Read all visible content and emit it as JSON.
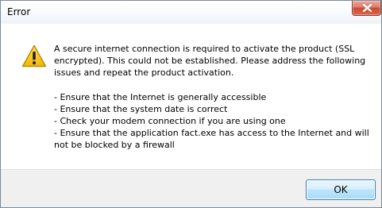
{
  "window": {
    "title": "Error"
  },
  "message": {
    "intro": "A secure internet connection is required to activate the product (SSL encrypted). This could not be established. Please address the following issues and repeat the product activation.",
    "items": [
      "- Ensure that the Internet is generally accessible",
      "- Ensure that the system date is correct",
      "- Check your modem connection if you are using one",
      "- Ensure that the application fact.exe has access to the Internet and will not be blocked by a firewall"
    ]
  },
  "buttons": {
    "ok_label": "OK"
  },
  "icons": {
    "warning": "warning-icon",
    "close": "close-icon"
  },
  "colors": {
    "close_button": "#c94a32",
    "warning_yellow": "#f5c400",
    "ok_border": "#3c7fb1"
  }
}
